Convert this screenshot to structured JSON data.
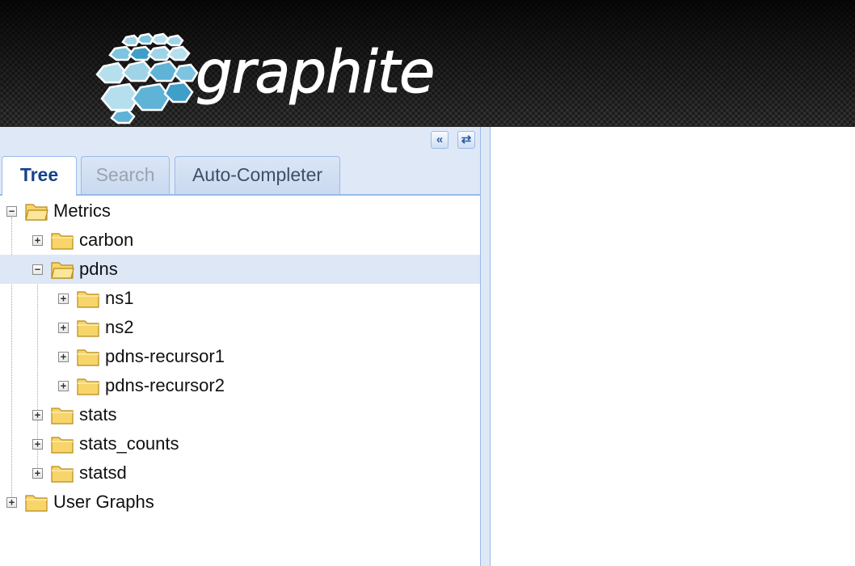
{
  "header": {
    "logo_text": "graphite",
    "logo_icon": "graphite-hexagon-logo-icon"
  },
  "toolbar": {
    "collapse_icon": "double-chevron-left-icon",
    "refresh_icon": "refresh-icon",
    "collapse_glyph": "«",
    "refresh_glyph": "⇄"
  },
  "tabs": [
    {
      "label": "Tree",
      "active": true
    },
    {
      "label": "Search",
      "active": false,
      "disabled": true
    },
    {
      "label": "Auto-Completer",
      "active": false
    }
  ],
  "tree": {
    "nodes": [
      {
        "label": "Metrics",
        "depth": 0,
        "expanded": true
      },
      {
        "label": "carbon",
        "depth": 1,
        "expanded": false
      },
      {
        "label": "pdns",
        "depth": 1,
        "expanded": true,
        "selected": true
      },
      {
        "label": "ns1",
        "depth": 2,
        "expanded": false
      },
      {
        "label": "ns2",
        "depth": 2,
        "expanded": false
      },
      {
        "label": "pdns-recursor1",
        "depth": 2,
        "expanded": false
      },
      {
        "label": "pdns-recursor2",
        "depth": 2,
        "expanded": false
      },
      {
        "label": "stats",
        "depth": 1,
        "expanded": false
      },
      {
        "label": "stats_counts",
        "depth": 1,
        "expanded": false
      },
      {
        "label": "statsd",
        "depth": 1,
        "expanded": false
      },
      {
        "label": "User Graphs",
        "depth": 0,
        "expanded": false
      }
    ]
  },
  "colors": {
    "accent_border": "#99bbe8",
    "panel_bg": "#dfe8f6",
    "selected_row": "#dde7f6",
    "folder_fill": "#f7d56b",
    "logo_blue": "#5fb3d6"
  }
}
